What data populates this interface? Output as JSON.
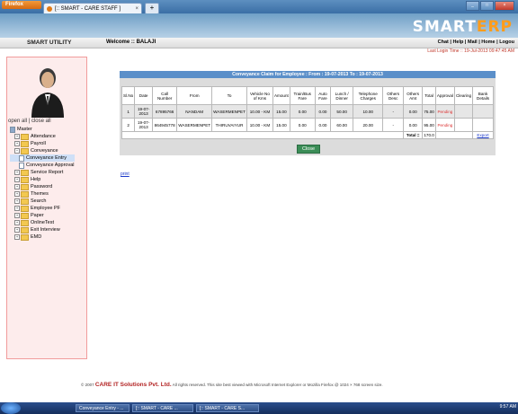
{
  "browser": {
    "menu_button": "Firefox",
    "tab_title": "[:: SMART - CARE STAFF ]",
    "new_tab": "+"
  },
  "header": {
    "logo_primary": "SMART",
    "logo_accent": "ERP",
    "brand": "SMART UTILITY",
    "welcome": "Welcome :: BALAJI",
    "links": [
      "Chat",
      "Help",
      "Mail",
      "Home",
      "Logou"
    ],
    "last_login": "Last Login Time :: 19-Jul-2013 09:47:45 AM"
  },
  "sidebar": {
    "openall": "open all",
    "closeall": "close all",
    "tree": [
      {
        "label": "Master",
        "level": 0,
        "type": "root"
      },
      {
        "label": "Attendance",
        "level": 1,
        "type": "folder"
      },
      {
        "label": "Payroll",
        "level": 1,
        "type": "folder"
      },
      {
        "label": "Conveyance",
        "level": 1,
        "type": "folder-open"
      },
      {
        "label": "Conveyance Entry",
        "level": 2,
        "type": "doc",
        "selected": true
      },
      {
        "label": "Conveyance Approval",
        "level": 2,
        "type": "doc"
      },
      {
        "label": "Service Report",
        "level": 1,
        "type": "folder"
      },
      {
        "label": "Help",
        "level": 1,
        "type": "folder"
      },
      {
        "label": "Password",
        "level": 1,
        "type": "folder"
      },
      {
        "label": "Themes",
        "level": 1,
        "type": "folder"
      },
      {
        "label": "Search",
        "level": 1,
        "type": "folder"
      },
      {
        "label": "Employee PF",
        "level": 1,
        "type": "folder"
      },
      {
        "label": "Paper",
        "level": 1,
        "type": "folder"
      },
      {
        "label": "OnlineTest",
        "level": 1,
        "type": "folder"
      },
      {
        "label": "Exit Interview",
        "level": 1,
        "type": "folder"
      },
      {
        "label": "EMD",
        "level": 1,
        "type": "folder"
      }
    ]
  },
  "main": {
    "panel_title": "Conveyance Claim for Employee : From : 19-07-2013 To : 19-07-2013",
    "columns": [
      "Sl.No",
      "Date",
      "Call Number",
      "From",
      "To",
      "Vehicle No of Kms",
      "Amount",
      "Train/Bus Fare",
      "Auto Fare",
      "Lunch / Dinner",
      "Telephone Charges",
      "Others Desc",
      "Others Amt",
      "Total",
      "Approval",
      "Clearing",
      "Bank Details"
    ],
    "rows": [
      [
        "1",
        "19-07-2013",
        "67895766",
        "NANDAM",
        "WASERMENPET",
        "10.00 - KM",
        "15.00",
        "0.00",
        "0.00",
        "50.00",
        "10.00",
        "-",
        "0.00",
        "75.00",
        "Pending",
        "",
        ""
      ],
      [
        "2",
        "19-07-2013",
        "864945778",
        "WASERMENPET",
        "THIRUVAIYUR",
        "10.00 - KM",
        "15.00",
        "0.00",
        "0.00",
        "60.00",
        "20.00",
        "-",
        "0.00",
        "95.00",
        "Pending",
        "",
        ""
      ]
    ],
    "total_label": "Total =",
    "total_value": "170.0",
    "export": "Export",
    "close_button": "Close",
    "print": "print"
  },
  "footer": {
    "copyright": "© 2007",
    "company": "CARE IT Solutions Pvt. Ltd.",
    "note": "All rights reserved.   This site best viewed with Microsoft Internet Explorer or Mozilla Firefox @ 1024 × 768 screen size."
  },
  "taskbar": {
    "items": [
      "Conveyance Entry - ...",
      "[:: SMART - CARE ...",
      "[:: SMART - CARE S..."
    ],
    "clock": "9:57 AM"
  },
  "colors": {
    "accent": "#ff9c1a",
    "header_blue": "#5b8fc9",
    "pending": "#d33333",
    "sidebar_bg": "#fdecec"
  }
}
